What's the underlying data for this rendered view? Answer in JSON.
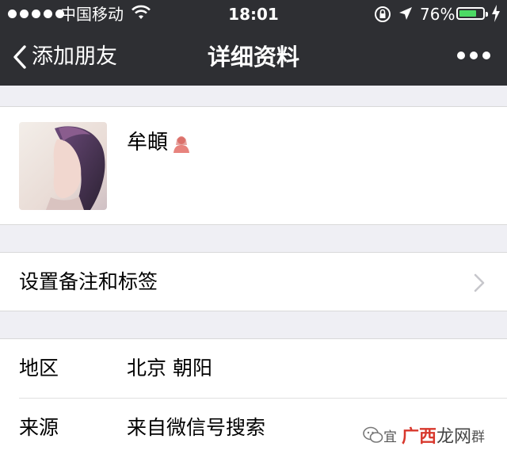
{
  "status_bar": {
    "carrier": "中国移动",
    "time": "18:01",
    "battery_percent": "76%",
    "battery_level": 0.76,
    "battery_color": "#4cd964"
  },
  "nav": {
    "back_label": "添加朋友",
    "title": "详细资料",
    "more_icon": "more-dots-icon"
  },
  "profile": {
    "name": "牟頔",
    "gender_icon": "female-person-icon"
  },
  "remark": {
    "label": "设置备注和标签"
  },
  "info": {
    "rows": [
      {
        "key": "地区",
        "value": "北京  朝阳"
      },
      {
        "key": "来源",
        "value": "来自微信号搜索"
      }
    ]
  },
  "watermark": {
    "prefix": "宜",
    "brand_red": "广西",
    "brand_gray": "龙网",
    "suffix": "群"
  },
  "colors": {
    "bar_bg": "#2e2f33",
    "page_bg": "#efeff4",
    "accent_red": "#d8382d"
  }
}
